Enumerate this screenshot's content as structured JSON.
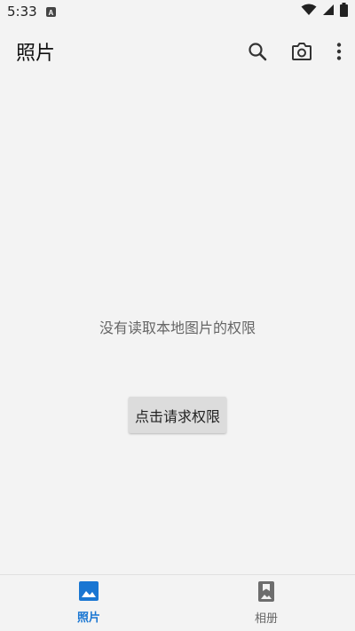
{
  "status_bar": {
    "time": "5:33",
    "notification_icon": "a-icon",
    "wifi_icon": "wifi-icon",
    "signal_icon": "signal-icon",
    "battery_icon": "battery-icon"
  },
  "app_bar": {
    "title": "照片",
    "search_icon": "search-icon",
    "camera_icon": "camera-icon",
    "more_icon": "more-vert-icon"
  },
  "main": {
    "message": "没有读取本地图片的权限",
    "request_button_label": "点击请求权限"
  },
  "bottom_nav": {
    "items": [
      {
        "label": "照片",
        "icon": "image-icon",
        "active": true
      },
      {
        "label": "相册",
        "icon": "album-icon",
        "active": false
      }
    ]
  },
  "colors": {
    "accent": "#1976d2",
    "background": "#f3f3f3",
    "button_bg": "#dcdcdc"
  }
}
